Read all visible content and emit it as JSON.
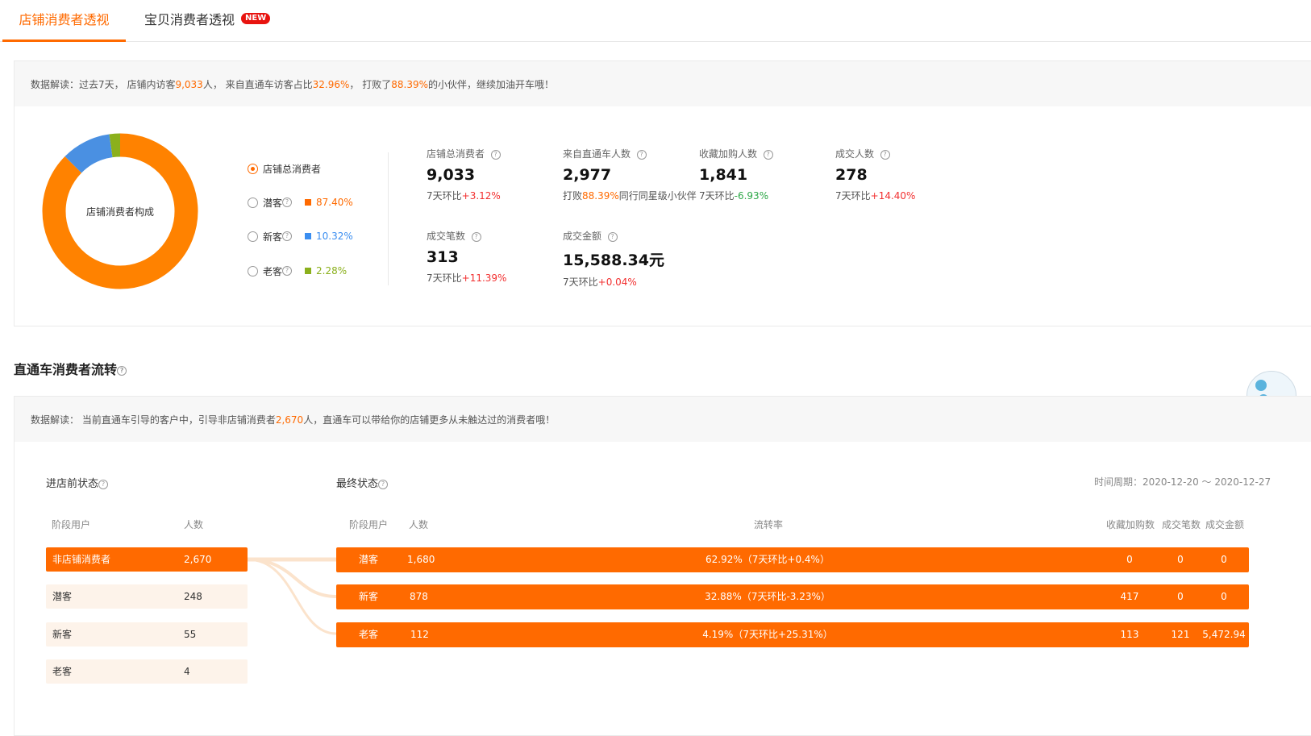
{
  "tabs": [
    {
      "label": "店铺消费者透视",
      "active": true
    },
    {
      "label": "宝贝消费者透视",
      "badge": "NEW",
      "active": false
    }
  ],
  "summary": {
    "prefix": "数据解读：过去7天，  店铺内访客",
    "visitors": "9,033",
    "mid1": "人，  来自直通车访客占比",
    "ratio": "32.96%",
    "mid2": "，  打败了",
    "beat": "88.39%",
    "suffix": "的小伙伴，继续加油开车哦！"
  },
  "donut": {
    "center_label": "店铺消费者构成",
    "segments": [
      {
        "name": "潜客",
        "value": 87.4,
        "color": "#ff8200"
      },
      {
        "name": "新客",
        "value": 10.32,
        "color": "#4a90e2"
      },
      {
        "name": "老客",
        "value": 2.28,
        "color": "#8bb01c"
      }
    ]
  },
  "legend": {
    "all": "店铺总消费者",
    "items": [
      {
        "label": "潜客",
        "pct": "87.40%",
        "color": "#ff6a00"
      },
      {
        "label": "新客",
        "pct": "10.32%",
        "color": "#3b8ef0"
      },
      {
        "label": "老客",
        "pct": "2.28%",
        "color": "#8bb01c"
      }
    ]
  },
  "metrics": {
    "total": {
      "label": "店铺总消费者",
      "value": "9,033",
      "sub_prefix": "7天环比",
      "sub_value": "+3.12%"
    },
    "ztc": {
      "label": "来自直通车人数",
      "value": "2,977",
      "sub_prefix": "打败",
      "sub_value": "88.39%",
      "sub_suffix": "同行同星级小伙伴"
    },
    "fav": {
      "label": "收藏加购人数",
      "value": "1,841",
      "sub_prefix": "7天环比",
      "sub_value": "-6.93%"
    },
    "deal": {
      "label": "成交人数",
      "value": "278",
      "sub_prefix": "7天环比",
      "sub_value": "+14.40%"
    },
    "orders": {
      "label": "成交笔数",
      "value": "313",
      "sub_prefix": "7天环比",
      "sub_value": "+11.39%"
    },
    "amount": {
      "label": "成交金额",
      "value": "15,588.34元",
      "sub_prefix": "7天环比",
      "sub_value": "+0.04%"
    }
  },
  "flow": {
    "title": "直通车消费者流转",
    "notice_prefix": "数据解读：  当前直通车引导的客户中，引导非店铺消费者",
    "notice_value": "2,670",
    "notice_suffix": "人，直通车可以带给你的店铺更多从未触达过的消费者哦！",
    "before_title": "进店前状态",
    "after_title": "最终状态",
    "period": "时间周期：2020-12-20 ～ 2020-12-27",
    "left_headers": [
      "阶段用户",
      "人数"
    ],
    "right_headers": [
      "阶段用户",
      "人数",
      "流转率",
      "收藏加购数",
      "成交笔数",
      "成交金额"
    ],
    "left_rows": [
      {
        "name": "非店铺消费者",
        "count": "2,670",
        "active": true
      },
      {
        "name": "潜客",
        "count": "248"
      },
      {
        "name": "新客",
        "count": "55"
      },
      {
        "name": "老客",
        "count": "4"
      }
    ],
    "right_rows": [
      {
        "name": "潜客",
        "count": "1,680",
        "rate": "62.92%（7天环比+0.4%）",
        "fav": "0",
        "orders": "0",
        "amount": "0"
      },
      {
        "name": "新客",
        "count": "878",
        "rate": "32.88%（7天环比-3.23%）",
        "fav": "417",
        "orders": "0",
        "amount": "0"
      },
      {
        "name": "老客",
        "count": "112",
        "rate": "4.19%（7天环比+25.31%）",
        "fav": "113",
        "orders": "121",
        "amount": "5,472.94"
      }
    ]
  }
}
